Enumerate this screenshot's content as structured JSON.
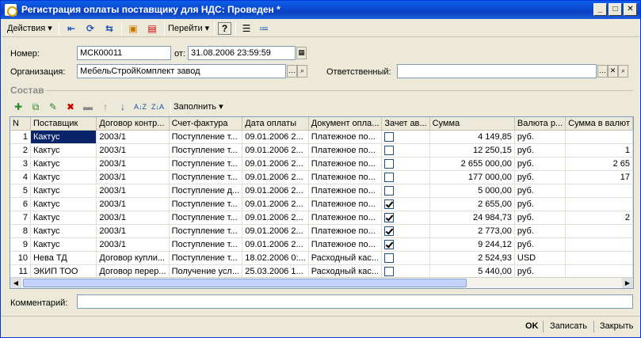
{
  "window": {
    "title": "Регистрация оплаты поставщику для НДС: Проведен *",
    "controls": [
      "_",
      "□",
      "✕"
    ]
  },
  "toolbar": {
    "actions_label": "Действия",
    "goto_label": "Перейти",
    "help_label": "?"
  },
  "form": {
    "number_label": "Номер:",
    "number_value": "МСК00011",
    "date_label": "от:",
    "date_value": "31.08.2006 23:59:59",
    "org_label": "Организация:",
    "org_value": "МебельСтройКомплект завод",
    "responsible_label": "Ответственный:",
    "responsible_value": "",
    "comment_label": "Комментарий:",
    "comment_value": ""
  },
  "section": {
    "title": "Состав",
    "fill_label": "Заполнить"
  },
  "table": {
    "columns": [
      "N",
      "Поставщик",
      "Договор контр...",
      "Счет-фактура",
      "Дата оплаты",
      "Документ опла...",
      "Зачет ав...",
      "Сумма",
      "Валюта р...",
      "Сумма в валют"
    ],
    "rows": [
      {
        "n": "1",
        "supplier": "Кактус",
        "contract": "2003/1",
        "invoice": "Поступление т...",
        "date": "09.01.2006 2...",
        "doc": "Платежное по...",
        "offset": false,
        "sum": "4 149,85",
        "currency": "руб.",
        "cur_sum": ""
      },
      {
        "n": "2",
        "supplier": "Кактус",
        "contract": "2003/1",
        "invoice": "Поступление т...",
        "date": "09.01.2006 2...",
        "doc": "Платежное по...",
        "offset": false,
        "sum": "12 250,15",
        "currency": "руб.",
        "cur_sum": "1"
      },
      {
        "n": "3",
        "supplier": "Кактус",
        "contract": "2003/1",
        "invoice": "Поступление т...",
        "date": "09.01.2006 2...",
        "doc": "Платежное по...",
        "offset": false,
        "sum": "2 655 000,00",
        "currency": "руб.",
        "cur_sum": "2 65"
      },
      {
        "n": "4",
        "supplier": "Кактус",
        "contract": "2003/1",
        "invoice": "Поступление т...",
        "date": "09.01.2006 2...",
        "doc": "Платежное по...",
        "offset": false,
        "sum": "177 000,00",
        "currency": "руб.",
        "cur_sum": "17"
      },
      {
        "n": "5",
        "supplier": "Кактус",
        "contract": "2003/1",
        "invoice": "Поступление д...",
        "date": "09.01.2006 2...",
        "doc": "Платежное по...",
        "offset": false,
        "sum": "5 000,00",
        "currency": "руб.",
        "cur_sum": ""
      },
      {
        "n": "6",
        "supplier": "Кактус",
        "contract": "2003/1",
        "invoice": "Поступление т...",
        "date": "09.01.2006 2...",
        "doc": "Платежное по...",
        "offset": true,
        "sum": "2 655,00",
        "currency": "руб.",
        "cur_sum": ""
      },
      {
        "n": "7",
        "supplier": "Кактус",
        "contract": "2003/1",
        "invoice": "Поступление т...",
        "date": "09.01.2006 2...",
        "doc": "Платежное по...",
        "offset": true,
        "sum": "24 984,73",
        "currency": "руб.",
        "cur_sum": "2"
      },
      {
        "n": "8",
        "supplier": "Кактус",
        "contract": "2003/1",
        "invoice": "Поступление т...",
        "date": "09.01.2006 2...",
        "doc": "Платежное по...",
        "offset": true,
        "sum": "2 773,00",
        "currency": "руб.",
        "cur_sum": ""
      },
      {
        "n": "9",
        "supplier": "Кактус",
        "contract": "2003/1",
        "invoice": "Поступление т...",
        "date": "09.01.2006 2...",
        "doc": "Платежное по...",
        "offset": true,
        "sum": "9 244,12",
        "currency": "руб.",
        "cur_sum": ""
      },
      {
        "n": "10",
        "supplier": "Нева ТД",
        "contract": "Договор купли...",
        "invoice": "Поступление т...",
        "date": "18.02.2006 0:...",
        "doc": "Расходный кас...",
        "offset": false,
        "sum": "2 524,93",
        "currency": "USD",
        "cur_sum": ""
      },
      {
        "n": "11",
        "supplier": "ЭКИП ТОО",
        "contract": "Договор перер...",
        "invoice": "Получение усл...",
        "date": "25.03.2006 1...",
        "doc": "Расходный кас...",
        "offset": false,
        "sum": "5 440,00",
        "currency": "руб.",
        "cur_sum": ""
      }
    ]
  },
  "footer": {
    "ok_label": "OK",
    "save_label": "Записать",
    "close_label": "Закрыть"
  }
}
